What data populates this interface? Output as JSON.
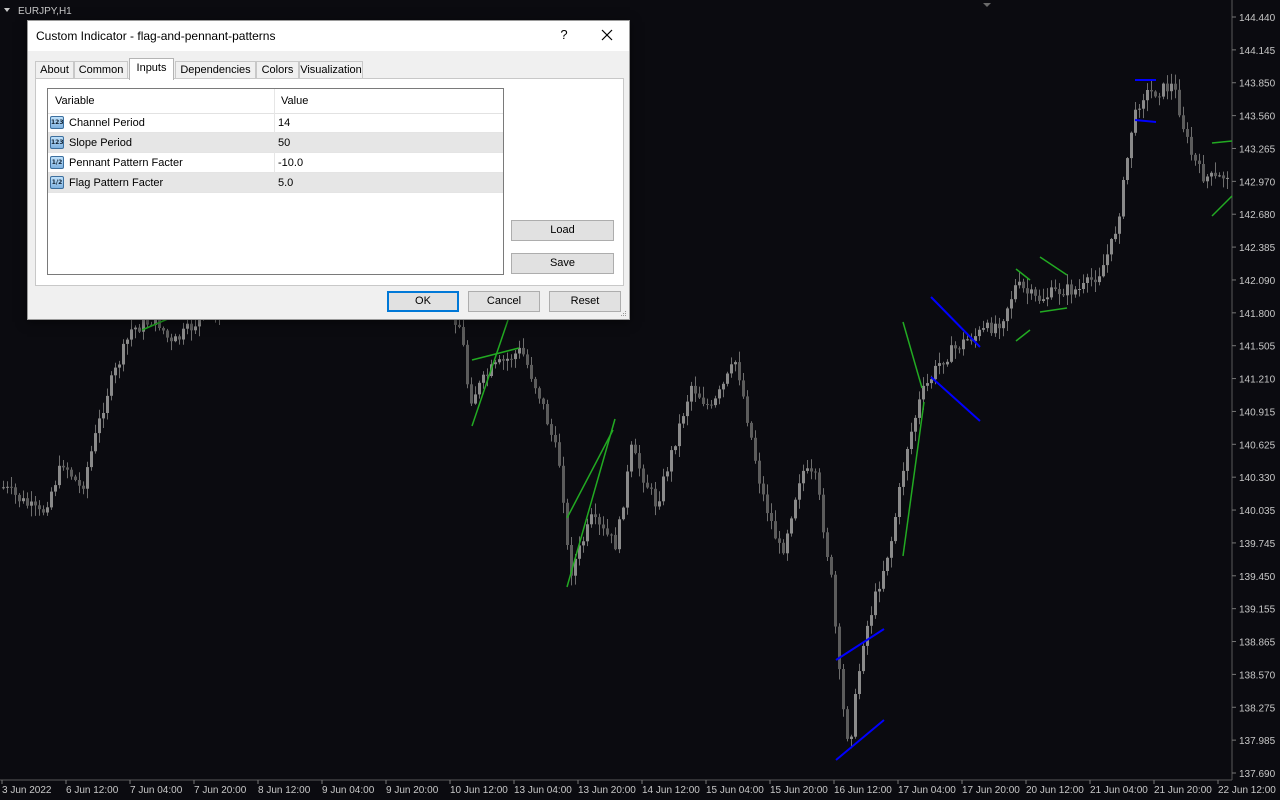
{
  "chart": {
    "symbol": "EURJPY,H1",
    "background": "#0b0b10",
    "candle_color": "#7a7a7a",
    "flag_line_color": "#0000ff",
    "pennant_line_color": "#22aa22",
    "price_labels": [
      "144.440",
      "144.145",
      "143.850",
      "143.560",
      "143.265",
      "142.970",
      "142.680",
      "142.385",
      "142.090",
      "141.800",
      "141.505",
      "141.210",
      "140.915",
      "140.625",
      "140.330",
      "140.035",
      "139.745",
      "139.450",
      "139.155",
      "138.865",
      "138.570",
      "138.275",
      "137.985",
      "137.690"
    ],
    "time_labels": [
      "3 Jun 2022",
      "6 Jun 12:00",
      "7 Jun 04:00",
      "7 Jun 20:00",
      "8 Jun 12:00",
      "9 Jun 04:00",
      "9 Jun 20:00",
      "10 Jun 12:00",
      "13 Jun 04:00",
      "13 Jun 20:00",
      "14 Jun 12:00",
      "15 Jun 04:00",
      "15 Jun 20:00",
      "16 Jun 12:00",
      "17 Jun 04:00",
      "17 Jun 20:00",
      "20 Jun 12:00",
      "21 Jun 04:00",
      "21 Jun 20:00",
      "22 Jun 12:00"
    ]
  },
  "dialog": {
    "title": "Custom Indicator - flag-and-pennant-patterns",
    "help": "?",
    "tabs": [
      "About",
      "Common",
      "Inputs",
      "Dependencies",
      "Colors",
      "Visualization"
    ],
    "active_tab": "Inputs",
    "table": {
      "headers": {
        "variable": "Variable",
        "value": "Value"
      },
      "rows": [
        {
          "icon": "123",
          "name": "Channel Period",
          "value": "14"
        },
        {
          "icon": "123",
          "name": "Slope Period",
          "value": "50"
        },
        {
          "icon": "1/2",
          "name": "Pennant Pattern Facter",
          "value": "-10.0"
        },
        {
          "icon": "1/2",
          "name": "Flag Pattern Facter",
          "value": "5.0"
        }
      ]
    },
    "buttons": {
      "load": "Load",
      "save": "Save",
      "ok": "OK",
      "cancel": "Cancel",
      "reset": "Reset"
    }
  }
}
